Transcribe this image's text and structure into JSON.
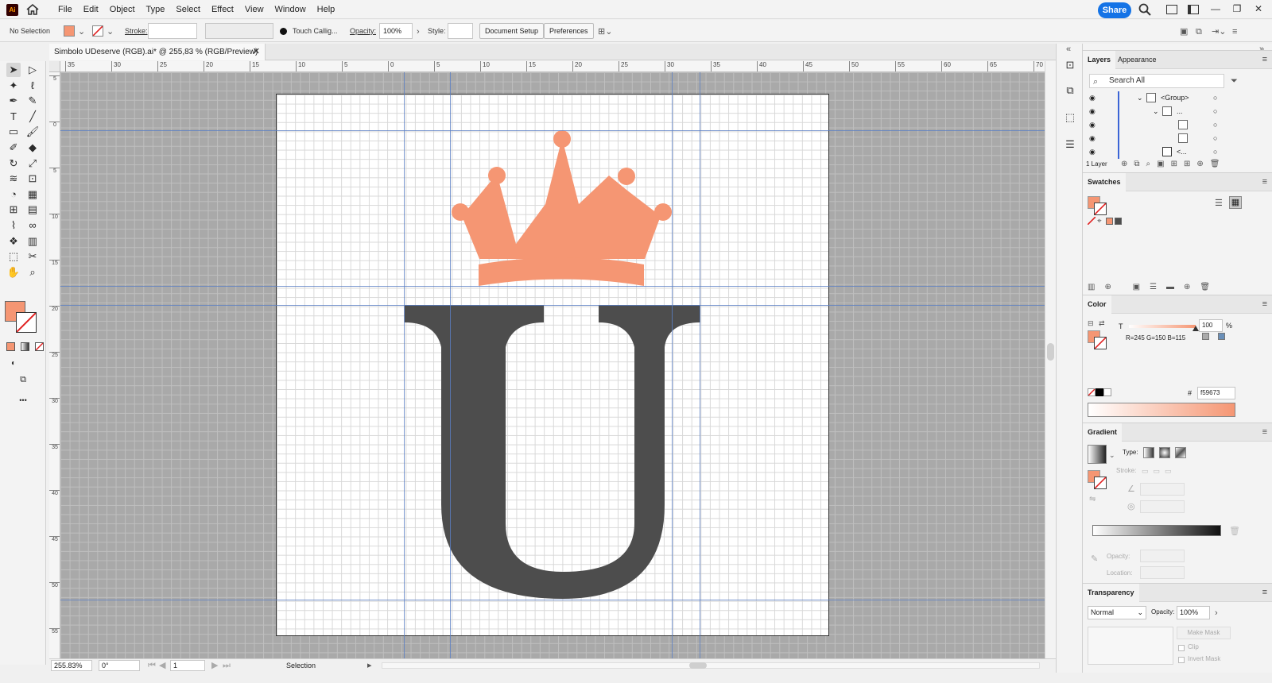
{
  "app": {
    "logo": "Ai",
    "menus": [
      "File",
      "Edit",
      "Object",
      "Type",
      "Select",
      "Effect",
      "View",
      "Window",
      "Help"
    ],
    "share_label": "Share",
    "window_controls": [
      "—",
      "❐",
      "✕"
    ]
  },
  "control_bar": {
    "selection": "No Selection",
    "stroke_label": "Stroke:",
    "brush": "Touch Callig...",
    "opacity_label": "Opacity:",
    "opacity_value": "100%",
    "style_label": "Style:",
    "document_setup": "Document Setup",
    "preferences": "Preferences"
  },
  "document": {
    "tab_title": "Simbolo UDeserve (RGB).ai* @ 255,83 % (RGB/Preview)",
    "close": "✕"
  },
  "tools": [
    {
      "name": "selection-tool",
      "glyph": "➤"
    },
    {
      "name": "direct-selection-tool",
      "glyph": "▷"
    },
    {
      "name": "magic-wand-tool",
      "glyph": "✦"
    },
    {
      "name": "lasso-tool",
      "glyph": "ℓ"
    },
    {
      "name": "pen-tool",
      "glyph": "✒"
    },
    {
      "name": "curvature-tool",
      "glyph": "✎"
    },
    {
      "name": "type-tool",
      "glyph": "T"
    },
    {
      "name": "line-tool",
      "glyph": "╱"
    },
    {
      "name": "rectangle-tool",
      "glyph": "▭"
    },
    {
      "name": "paintbrush-tool",
      "glyph": "🖌"
    },
    {
      "name": "shaper-tool",
      "glyph": "✐"
    },
    {
      "name": "eraser-tool",
      "glyph": "◆"
    },
    {
      "name": "rotate-tool",
      "glyph": "↻"
    },
    {
      "name": "scale-tool",
      "glyph": "⤢"
    },
    {
      "name": "warp-tool",
      "glyph": "≋"
    },
    {
      "name": "free-transform-tool",
      "glyph": "⊡"
    },
    {
      "name": "shape-builder-tool",
      "glyph": "◔"
    },
    {
      "name": "perspective-grid-tool",
      "glyph": "▦"
    },
    {
      "name": "mesh-tool",
      "glyph": "⊞"
    },
    {
      "name": "gradient-tool",
      "glyph": "▤"
    },
    {
      "name": "eyedropper-tool",
      "glyph": "⌇"
    },
    {
      "name": "blend-tool",
      "glyph": "∞"
    },
    {
      "name": "symbol-sprayer-tool",
      "glyph": "❖"
    },
    {
      "name": "column-graph-tool",
      "glyph": "▥"
    },
    {
      "name": "artboard-tool",
      "glyph": "⬚"
    },
    {
      "name": "slice-tool",
      "glyph": "✂"
    },
    {
      "name": "hand-tool",
      "glyph": "✋"
    },
    {
      "name": "zoom-tool",
      "glyph": "⌕"
    },
    {
      "name": "more-tools",
      "glyph": "•••"
    }
  ],
  "rulers": {
    "h_labels": [
      "35",
      "30",
      "25",
      "20",
      "15",
      "10",
      "5",
      "0",
      "5",
      "10",
      "15",
      "20",
      "25",
      "30",
      "35",
      "40",
      "45",
      "50",
      "55",
      "60",
      "65",
      "70"
    ],
    "v_labels": [
      "5",
      "0",
      "5",
      "10",
      "15",
      "20",
      "25",
      "30",
      "35",
      "40",
      "45",
      "50",
      "55"
    ]
  },
  "artwork": {
    "crown_color": "#f59673",
    "letter_color": "#4d4d4d",
    "letter": "U"
  },
  "status_bar": {
    "zoom": "255.83%",
    "rotation": "0°",
    "artboard": "1",
    "tool": "Selection"
  },
  "layers_panel": {
    "tabs": [
      "Layers",
      "Appearance"
    ],
    "search_placeholder": "Search All",
    "rows": [
      "<Group>",
      "...",
      "",
      "",
      "<..."
    ],
    "footer": "1 Layer"
  },
  "swatches_panel": {
    "title": "Swatches"
  },
  "color_panel": {
    "title": "Color",
    "channel": "T",
    "tint_value": "100",
    "percent": "%",
    "rgb_readout": "R=245 G=150 B=115",
    "hex_label": "#",
    "hex_value": "f59673",
    "fill_color": "#f59673"
  },
  "gradient_panel": {
    "title": "Gradient",
    "type_label": "Type:",
    "stroke_label": "Stroke:",
    "opacity_label": "Opacity:",
    "location_label": "Location:"
  },
  "transparency_panel": {
    "title": "Transparency",
    "mode": "Normal",
    "opacity_label": "Opacity:",
    "opacity_value": "100%",
    "make_mask": "Make Mask",
    "clip": "Clip",
    "invert_mask": "Invert Mask"
  }
}
